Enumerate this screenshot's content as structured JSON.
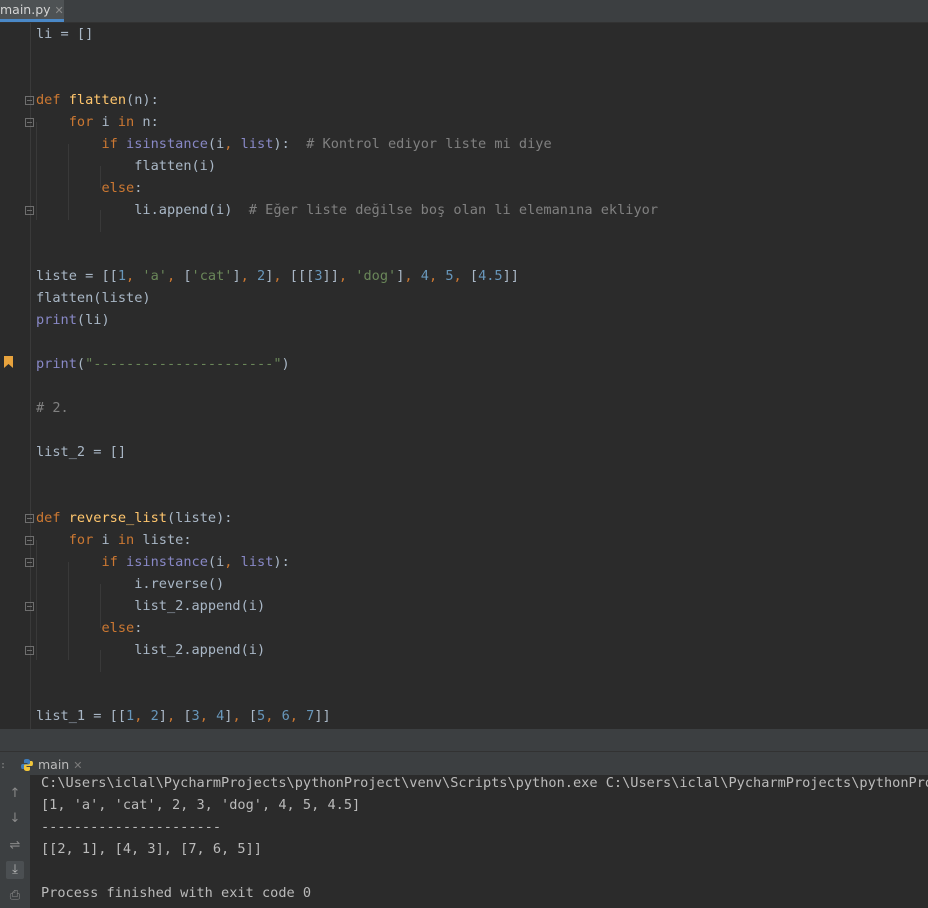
{
  "tab": {
    "label": "main.py",
    "close": "✕"
  },
  "code": [
    "li = []",
    "",
    "",
    "def flatten(n):",
    "    for i in n:",
    "        if isinstance(i, list):  # Kontrol ediyor liste mi diye",
    "            flatten(i)",
    "        else:",
    "            li.append(i)  # Eğer liste değilse boş olan li elemanına ekliyor",
    "",
    "",
    "liste = [[1, 'a', ['cat'], 2], [[[3]], 'dog'], 4, 5, [4.5]]",
    "flatten(liste)",
    "print(li)",
    "",
    "print(\"----------------------\")",
    "",
    "# 2.",
    "",
    "list_2 = []",
    "",
    "",
    "def reverse_list(liste):",
    "    for i in liste:",
    "        if isinstance(i, list):",
    "            i.reverse()",
    "            list_2.append(i)",
    "        else:",
    "            list_2.append(i)",
    "",
    "",
    "list_1 = [[1, 2], [3, 4], [5, 6, 7]]"
  ],
  "run": {
    "tab_label": "main",
    "close": "✕"
  },
  "console": [
    "C:\\Users\\iclal\\PycharmProjects\\pythonProject\\venv\\Scripts\\python.exe C:\\Users\\iclal\\PycharmProjects\\pythonProje",
    "[1, 'a', 'cat', 2, 3, 'dog', 4, 5, 4.5]",
    "----------------------",
    "[[2, 1], [4, 3], [7, 6, 5]]",
    "",
    "Process finished with exit code 0"
  ],
  "icons": [
    "close-icon",
    "fold-icon",
    "bookmark-icon",
    "python-icon",
    "arrow-up-icon",
    "arrow-down-icon",
    "soft-wrap-icon",
    "scroll-to-end-icon",
    "print-icon"
  ],
  "colors": {
    "background": "#2b2b2b",
    "keyword": "#cc7832",
    "function": "#ffc66d",
    "builtin": "#8888c6",
    "string": "#6a8759",
    "number": "#6897bb",
    "comment": "#808080"
  }
}
